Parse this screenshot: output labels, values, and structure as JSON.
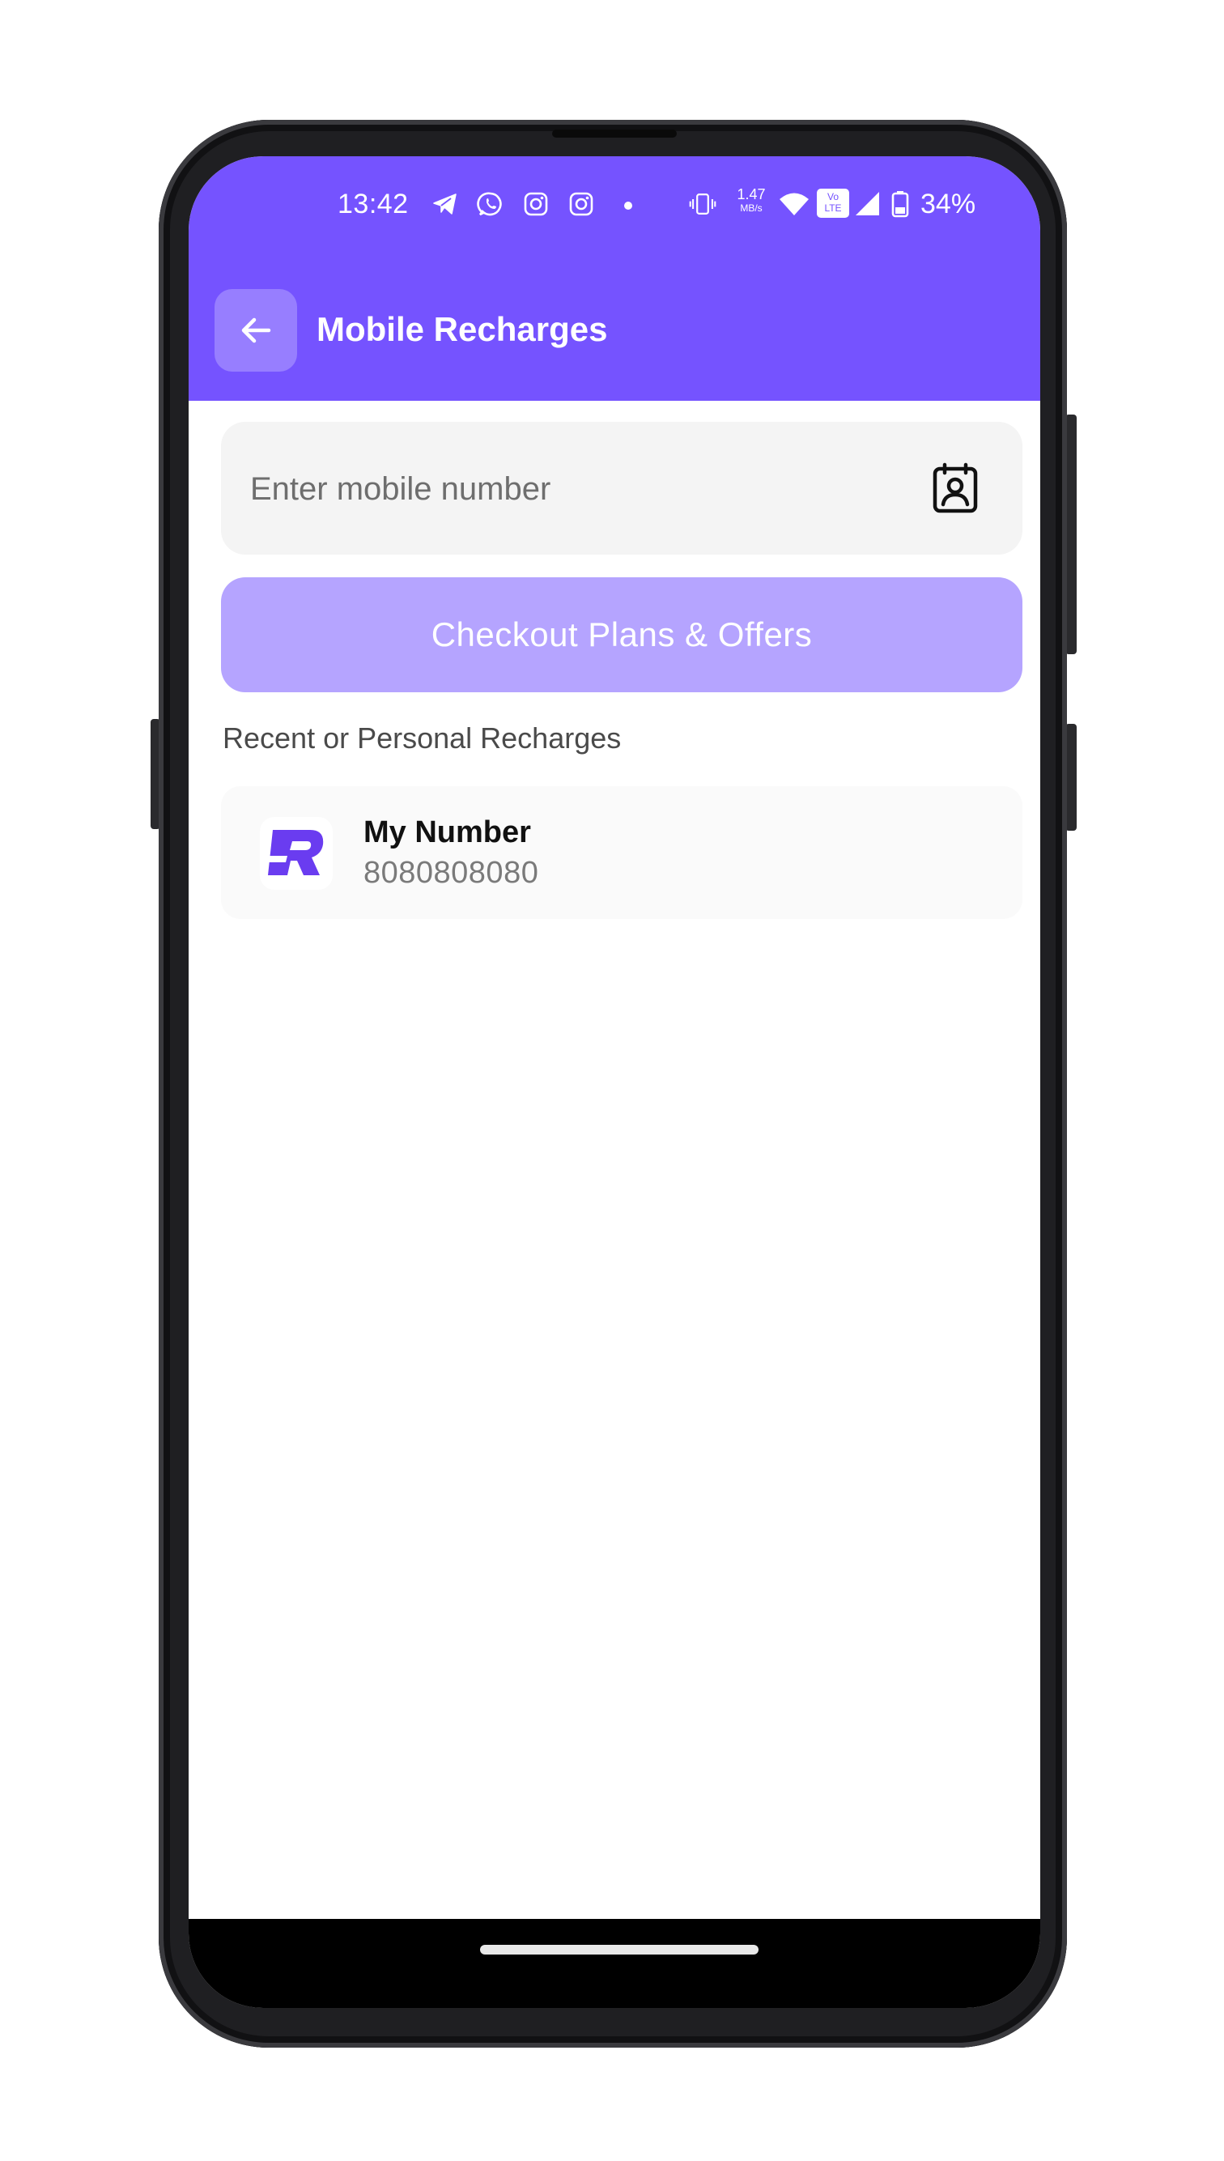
{
  "status_bar": {
    "time": "13:42",
    "speed_value": "1.47",
    "speed_unit": "MB/s",
    "volte_top": "Vo",
    "volte_bottom": "LTE",
    "battery": "34%",
    "icons": [
      "telegram-icon",
      "whatsapp-icon",
      "instagram-icon",
      "instagram-icon",
      "vibrate-icon",
      "wifi-icon",
      "signal-icon",
      "battery-icon"
    ]
  },
  "header": {
    "title": "Mobile Recharges",
    "back_icon": "arrow-left-icon"
  },
  "number_input": {
    "placeholder": "Enter mobile number",
    "value": "",
    "contact_icon": "contact-book-icon"
  },
  "checkout_button": {
    "label": "Checkout Plans & Offers"
  },
  "recent": {
    "section_title": "Recent or Personal Recharges",
    "items": [
      {
        "name": "My Number",
        "number": "8080808080",
        "logo": "R-logo"
      }
    ]
  },
  "colors": {
    "primary": "#7553FF",
    "button_disabled": "#B5A4FF",
    "field_bg": "#F4F4F4"
  }
}
